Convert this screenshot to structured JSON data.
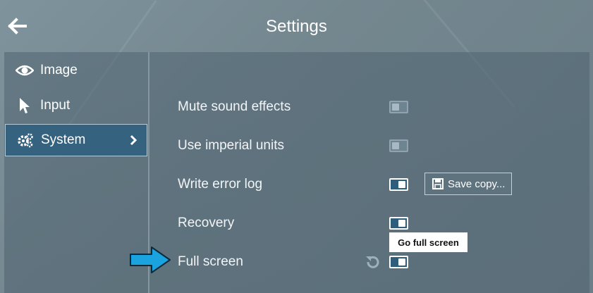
{
  "header": {
    "title": "Settings",
    "back_icon": "arrow-left-icon"
  },
  "sidebar": {
    "items": [
      {
        "label": "Image",
        "icon": "eye-icon",
        "active": false
      },
      {
        "label": "Input",
        "icon": "cursor-icon",
        "active": false
      },
      {
        "label": "System",
        "icon": "gears-icon",
        "active": true
      }
    ]
  },
  "settings": {
    "mute_sound_effects": {
      "label": "Mute sound effects",
      "enabled": false
    },
    "use_imperial_units": {
      "label": "Use imperial units",
      "enabled": false
    },
    "write_error_log": {
      "label": "Write error log",
      "enabled": true,
      "button_label": "Save copy..."
    },
    "recovery": {
      "label": "Recovery",
      "enabled": true
    },
    "full_screen": {
      "label": "Full screen",
      "enabled": true,
      "tooltip": "Go full screen"
    }
  },
  "colors": {
    "accent": "#35627f",
    "highlight_arrow": "#1aa3de"
  }
}
